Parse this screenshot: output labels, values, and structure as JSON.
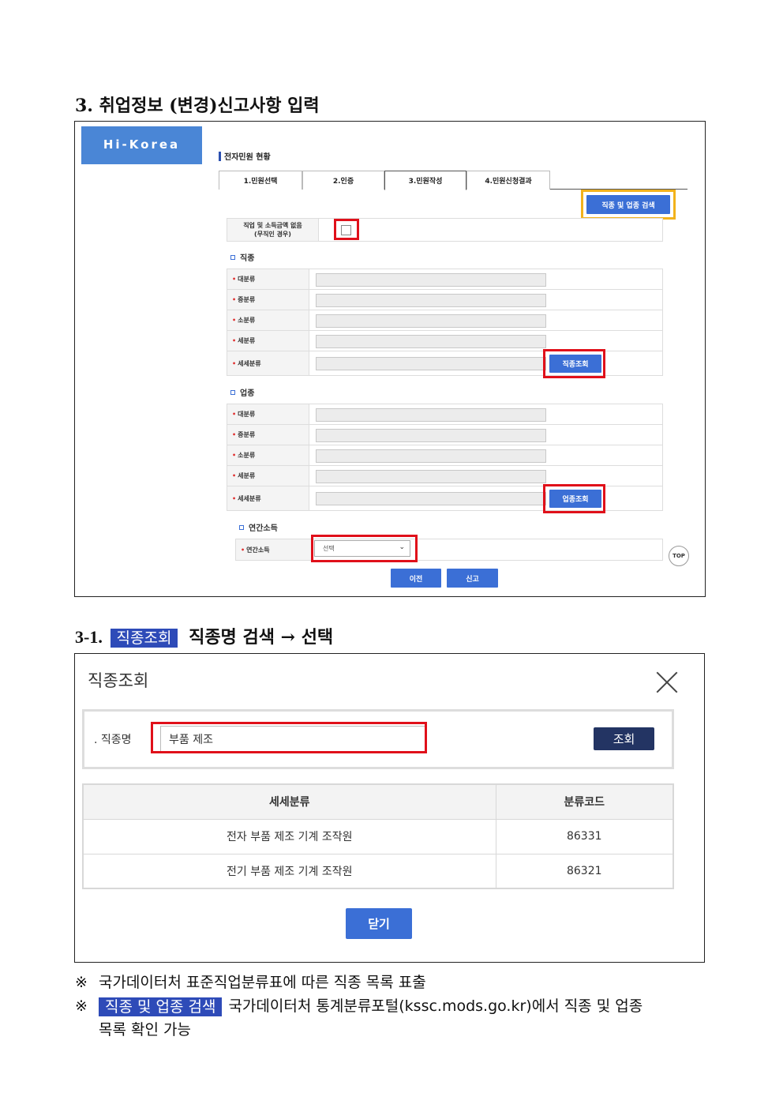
{
  "section3": {
    "title": "3.  취업정보 (변경)신고사항 입력",
    "logo": "Hi-Korea",
    "header": "전자민원 현황",
    "tabs": [
      "1.민원선택",
      "2.인증",
      "3.민원작성",
      "4.민원신청결과"
    ],
    "search_button": "직종 및 업종 검색",
    "no_job_label_1": "직업 및 소득금액 없음",
    "no_job_label_2": "(무직인 경우)",
    "occupation": {
      "heading": "직종",
      "rows": [
        "대분류",
        "중분류",
        "소분류",
        "세분류",
        "세세분류"
      ],
      "lookup_button": "직종조회"
    },
    "industry": {
      "heading": "업종",
      "rows": [
        "대분류",
        "중분류",
        "소분류",
        "세분류",
        "세세분류"
      ],
      "lookup_button": "업종조회"
    },
    "income": {
      "heading": "연간소득",
      "label": "연간소득",
      "select_value": "선택"
    },
    "top_button": "TOP",
    "prev_button": "이전",
    "submit_button": "신고"
  },
  "section31": {
    "title_prefix": "3-1.",
    "title_chip": "직종조회",
    "title_suffix": " 직종명  검색  →  선택",
    "dialog_title": "직종조회",
    "search_label": "직종명",
    "search_value": "부품 제조",
    "search_button": "조회",
    "table_headers": [
      "세세분류",
      "분류코드"
    ],
    "table_rows": [
      [
        "전자 부품 제조 기계 조작원",
        "86331"
      ],
      [
        "전기 부품 제조 기계 조작원",
        "86321"
      ]
    ],
    "close_button": "닫기"
  },
  "notes": {
    "mark": "※",
    "note1": "국가데이터처  표준직업분류표에  따른  직종  목록  표출",
    "note2_chip": "직종  및  업종  검색",
    "note2_text": "국가데이터처  통계분류포털(kssc.mods.go.kr)에서  직종  및  업종",
    "note2_cont": "목록  확인  가능"
  }
}
